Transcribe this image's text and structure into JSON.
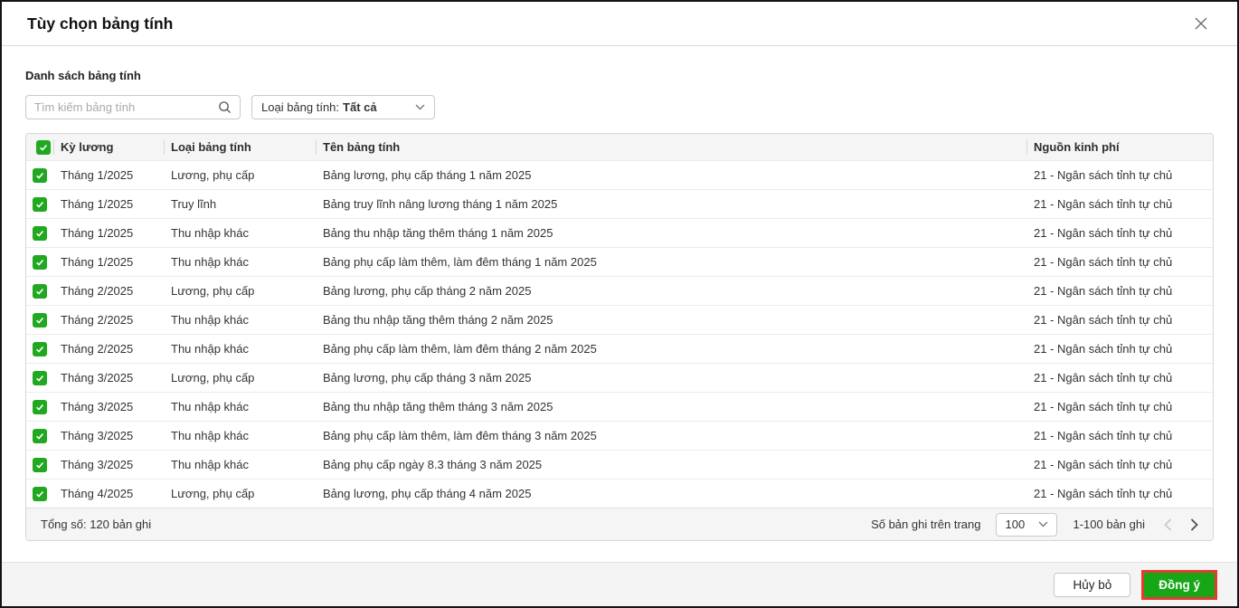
{
  "dialog": {
    "title": "Tùy chọn bảng tính"
  },
  "list_section": {
    "label": "Danh sách bảng tính",
    "search_placeholder": "Tìm kiếm bảng tính",
    "filter_label": "Loại bảng tính:",
    "filter_value": "Tất cả"
  },
  "table": {
    "headers": [
      "Kỳ lương",
      "Loại bảng tính",
      "Tên bảng tính",
      "Nguồn kinh phí"
    ],
    "select_all_checked": true,
    "rows": [
      {
        "checked": true,
        "period": "Tháng 1/2025",
        "type": "Lương, phụ cấp",
        "name": "Bảng lương, phụ cấp tháng 1 năm 2025",
        "fund": "21 - Ngân sách tỉnh tự chủ"
      },
      {
        "checked": true,
        "period": "Tháng 1/2025",
        "type": "Truy lĩnh",
        "name": "Bảng truy lĩnh nâng lương tháng 1 năm 2025",
        "fund": "21 - Ngân sách tỉnh tự chủ"
      },
      {
        "checked": true,
        "period": "Tháng 1/2025",
        "type": "Thu nhập khác",
        "name": "Bảng thu nhập tăng thêm tháng 1 năm 2025",
        "fund": "21 - Ngân sách tỉnh tự chủ"
      },
      {
        "checked": true,
        "period": "Tháng 1/2025",
        "type": "Thu nhập khác",
        "name": "Bảng phụ cấp làm thêm, làm đêm tháng 1 năm 2025",
        "fund": "21 - Ngân sách tỉnh tự chủ"
      },
      {
        "checked": true,
        "period": "Tháng 2/2025",
        "type": "Lương, phụ cấp",
        "name": "Bảng lương, phụ cấp tháng 2 năm 2025",
        "fund": "21 - Ngân sách tỉnh tự chủ"
      },
      {
        "checked": true,
        "period": "Tháng 2/2025",
        "type": "Thu nhập khác",
        "name": "Bảng thu nhập tăng thêm tháng 2 năm 2025",
        "fund": "21 - Ngân sách tỉnh tự chủ"
      },
      {
        "checked": true,
        "period": "Tháng 2/2025",
        "type": "Thu nhập khác",
        "name": "Bảng phụ cấp làm thêm, làm đêm tháng 2 năm 2025",
        "fund": "21 - Ngân sách tỉnh tự chủ"
      },
      {
        "checked": true,
        "period": "Tháng 3/2025",
        "type": "Lương, phụ cấp",
        "name": "Bảng lương, phụ cấp tháng 3 năm 2025",
        "fund": "21 - Ngân sách tỉnh tự chủ"
      },
      {
        "checked": true,
        "period": "Tháng 3/2025",
        "type": "Thu nhập khác",
        "name": "Bảng thu nhập tăng thêm tháng 3 năm 2025",
        "fund": "21 - Ngân sách tỉnh tự chủ"
      },
      {
        "checked": true,
        "period": "Tháng 3/2025",
        "type": "Thu nhập khác",
        "name": "Bảng phụ cấp làm thêm, làm đêm tháng 3 năm 2025",
        "fund": "21 - Ngân sách tỉnh tự chủ"
      },
      {
        "checked": true,
        "period": "Tháng 3/2025",
        "type": "Thu nhập khác",
        "name": "Bảng phụ cấp ngày 8.3 tháng 3 năm 2025",
        "fund": "21 - Ngân sách tỉnh tự chủ"
      },
      {
        "checked": true,
        "period": "Tháng 4/2025",
        "type": "Lương, phụ cấp",
        "name": "Bảng lương, phụ cấp tháng 4 năm 2025",
        "fund": "21 - Ngân sách tỉnh tự chủ"
      }
    ],
    "footer": {
      "total_text": "Tổng số: 120 bản ghi",
      "page_size_label": "Số bản ghi trên trang",
      "page_size_value": "100",
      "range_text": "1-100 bản ghi"
    }
  },
  "actions": {
    "cancel_label": "Hủy bỏ",
    "confirm_label": "Đồng ý"
  },
  "colors": {
    "checkbox_green": "#21a821",
    "confirm_green": "#16a616",
    "highlight_red": "#e8392e"
  }
}
